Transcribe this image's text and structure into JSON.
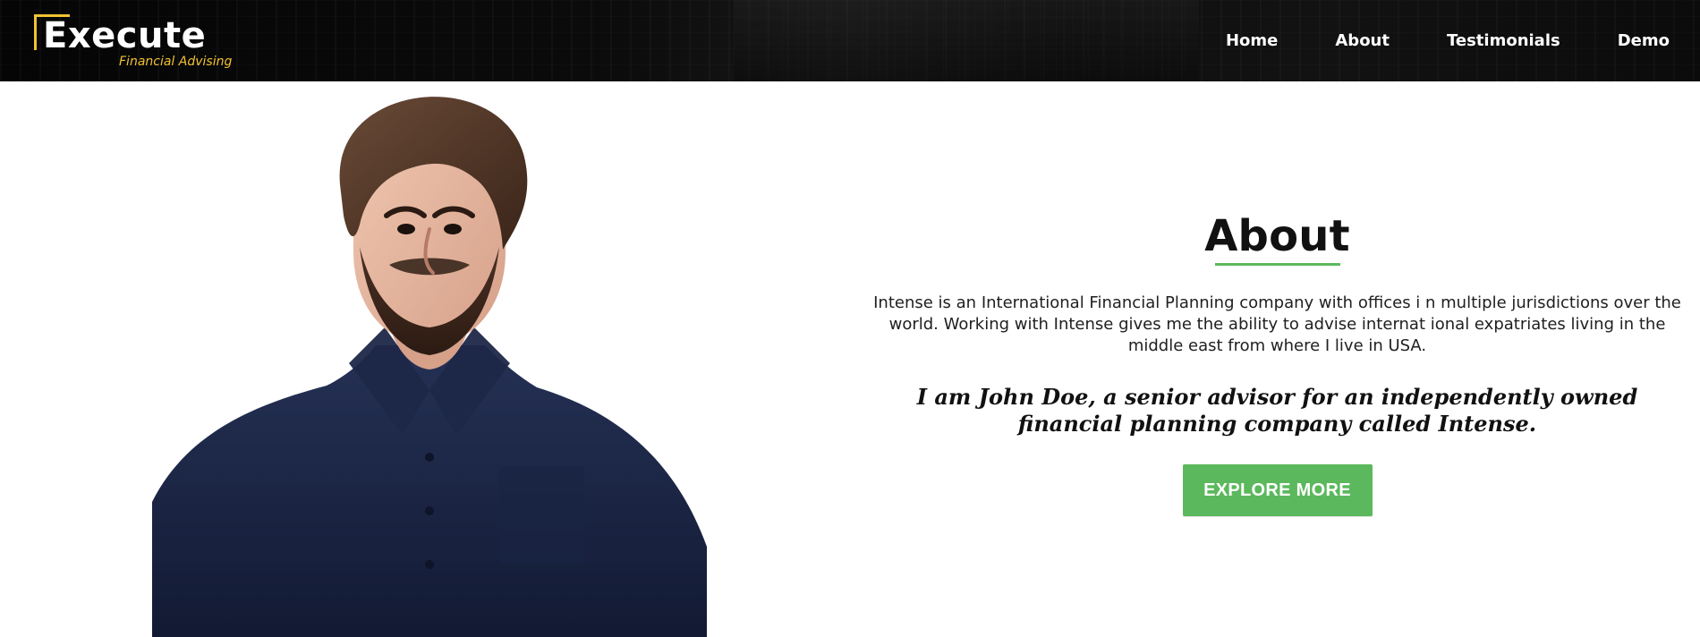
{
  "brand": {
    "title": "Execute",
    "subtitle": "Financial Advising",
    "accent_color": "#f1c232"
  },
  "nav": {
    "items": [
      {
        "label": "Home"
      },
      {
        "label": "About"
      },
      {
        "label": "Testimonials"
      },
      {
        "label": "Demo"
      }
    ]
  },
  "about": {
    "title": "About",
    "paragraph": "Intense is an International Financial Planning company with offices i n multiple jurisdictions over the world. Working with Intense gives me the ability to advise internat ional expatriates living in the middle east from where I live in USA.",
    "quote": "I am John Doe, a senior advisor for an independently owned financial planning company called Intense.",
    "button_label": "EXPLORE MORE",
    "button_color": "#5cb85c",
    "underline_color": "#5cb85c"
  }
}
